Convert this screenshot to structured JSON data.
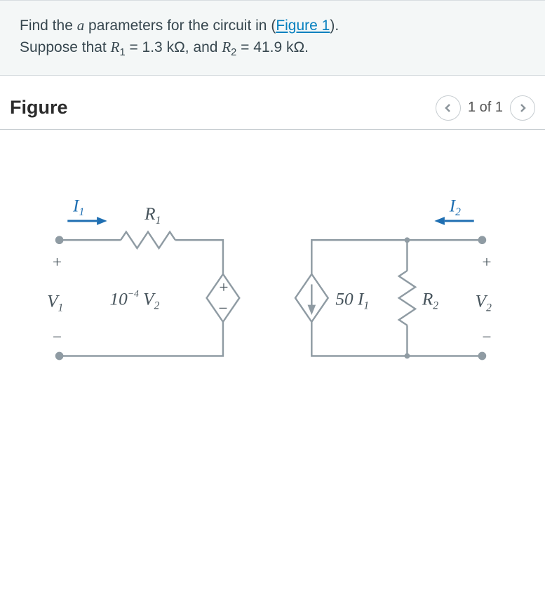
{
  "prompt": {
    "line1_pre": "Find the ",
    "param_letter": "a",
    "line1_mid": " parameters for the circuit in (",
    "figure_link": "Figure 1",
    "line1_post": ").",
    "line2_pre": "Suppose that ",
    "R1_sym": "R",
    "R1_sub": "1",
    "eq": " = ",
    "R1_val": "1.3 kΩ",
    "and": ", and ",
    "R2_sym": "R",
    "R2_sub": "2",
    "R2_val": "41.9 kΩ",
    "period": "."
  },
  "figure": {
    "title": "Figure",
    "pager": "1 of 1"
  },
  "circuit": {
    "I1": "I",
    "I1_sub": "1",
    "I2": "I",
    "I2_sub": "2",
    "R1": "R",
    "R1_sub": "1",
    "R2": "R",
    "R2_sub": "2",
    "V1": "V",
    "V1_sub": "1",
    "V2": "V",
    "V2_sub": "2",
    "vccs_pre": "10",
    "vccs_exp": "−4",
    "vccs_V": " V",
    "vccs_sub": "2",
    "cccs_pre": "50 ",
    "cccs_I": "I",
    "cccs_sub": "1",
    "plus": "+",
    "minus": "−"
  }
}
